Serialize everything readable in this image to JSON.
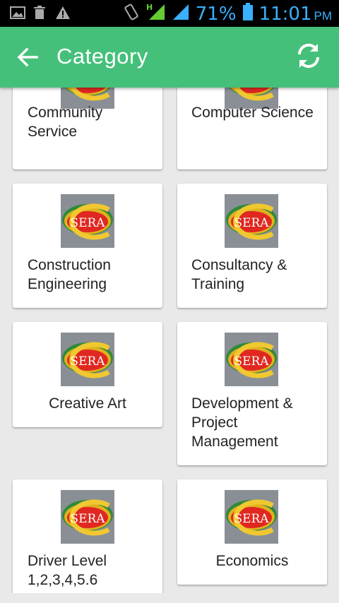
{
  "status_bar": {
    "battery": "71%",
    "time": "11:01",
    "ampm": "PM"
  },
  "app_bar": {
    "title": "Category"
  },
  "logo_text": "SERA",
  "categories": [
    {
      "label": "Community Service"
    },
    {
      "label": "Computer Science"
    },
    {
      "label": "Construction Engineering"
    },
    {
      "label": "Consultancy & Training"
    },
    {
      "label": "Creative Art"
    },
    {
      "label": "Development & Project Management"
    },
    {
      "label": "Driver Level 1,2,3,4,5.6"
    },
    {
      "label": "Economics"
    }
  ],
  "colors": {
    "app_bar": "#45c07a",
    "background": "#e9e9e9",
    "status_icons": "#3ab0ff"
  }
}
